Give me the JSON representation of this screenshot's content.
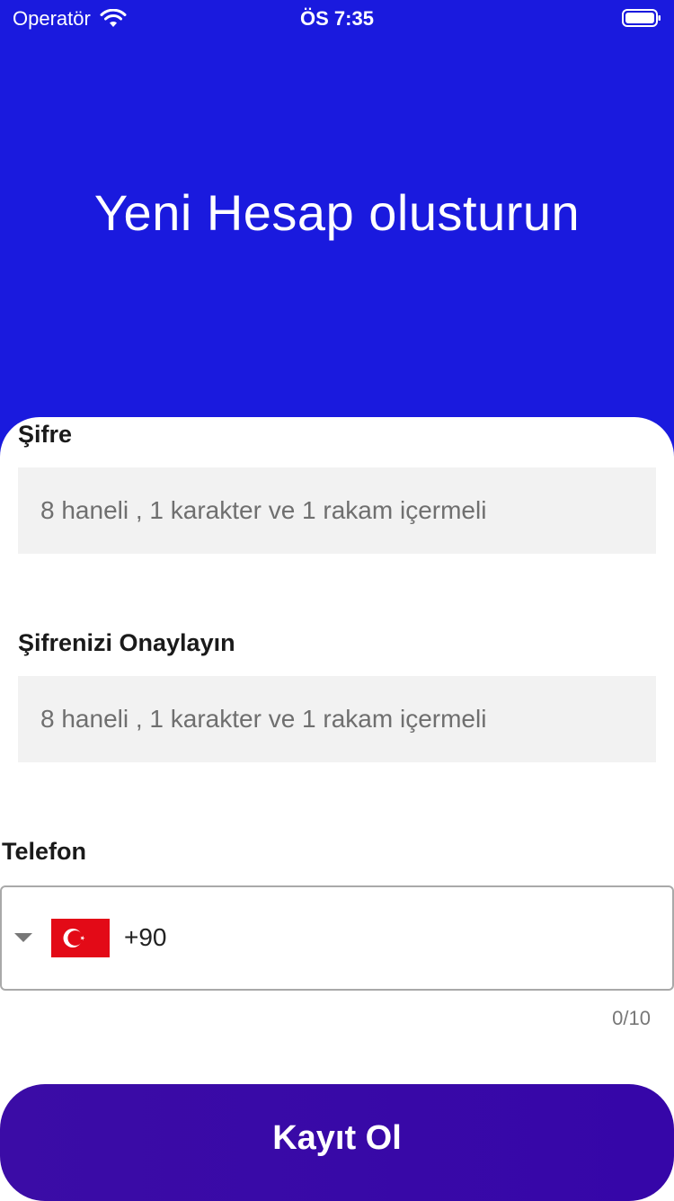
{
  "status_bar": {
    "carrier": "Operatör",
    "time": "ÖS 7:35"
  },
  "header": {
    "title": "Yeni Hesap olusturun",
    "background_color": "#1a1ade"
  },
  "form": {
    "password": {
      "label": "Şifre",
      "placeholder": "8 haneli , 1 karakter ve 1 rakam içermeli",
      "value": ""
    },
    "confirm_password": {
      "label": "Şifrenizi Onaylayın",
      "placeholder": "8 haneli , 1 karakter ve 1 rakam içermeli",
      "value": ""
    },
    "phone": {
      "label": "Telefon",
      "country_flag": "turkey-flag-icon",
      "dial_code": "+90",
      "value": "",
      "counter": "0/10"
    }
  },
  "submit": {
    "label": "Kayıt Ol",
    "color": "#3a0aa6"
  }
}
